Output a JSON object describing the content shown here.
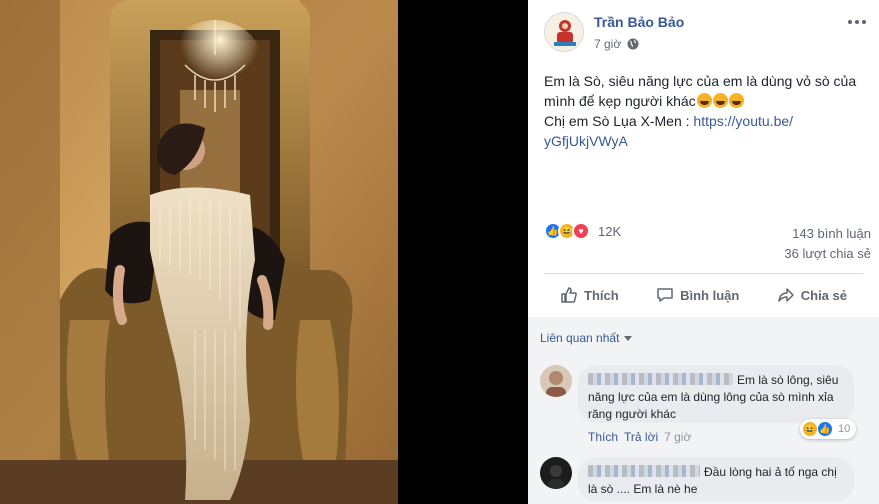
{
  "post": {
    "author": "Trần Bảo Bảo",
    "time": "7 giờ",
    "privacy_icon": "globe-icon",
    "text_line1": "Em là Sò, siêu năng lực của em là dùng vỏ sò của mình để kẹp người khác",
    "text_line2": "Chị em Sò Lụa X-Men : ",
    "link": "https://youtu.be/yGfjUkjVWyA",
    "link_part1": "https://youtu.be/",
    "link_part2": "yGfjUkjVWyA"
  },
  "stats": {
    "reactions": "12K",
    "comments": "143 bình luận",
    "shares": "36 lượt chia sẻ"
  },
  "actions": {
    "like": "Thích",
    "comment": "Bình luận",
    "share": "Chia sẻ"
  },
  "comments_section": {
    "sort_label": "Liên quan nhất",
    "items": [
      {
        "text": "Em là sò lông, siêu năng lực của em là dùng lông của sò mình xỉa răng người khác",
        "text_first": "Em là sò lông, siêu",
        "text_rest": "năng lực của em là dùng lông của sò mình xỉa răng người khác",
        "like": "Thích",
        "reply": "Trả lời",
        "time": "7 giờ",
        "reaction_count": "10"
      },
      {
        "text": "Đầu lòng hai ả tố nga chị là sò .... Em là nè he",
        "text_first": "Đầu lòng hai ả tố nga chị",
        "text_rest": "là sò .... Em là nè he"
      }
    ]
  },
  "colors": {
    "link": "#385898",
    "muted": "#606770",
    "like_blue": "#1877f2",
    "haha_yellow": "#f7b125",
    "love_red": "#f33e58"
  }
}
